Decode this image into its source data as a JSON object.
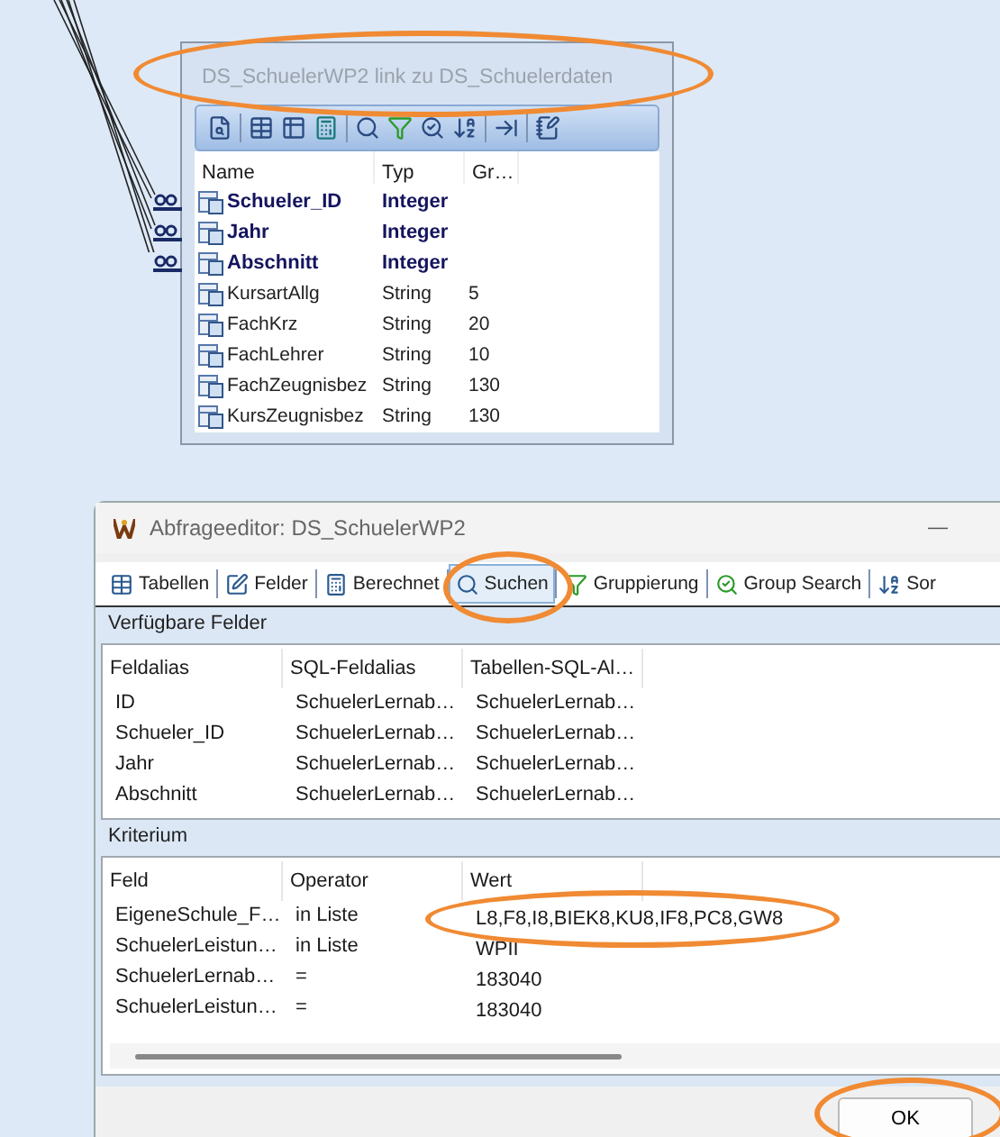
{
  "table_node": {
    "title": "DS_SchuelerWP2 link zu DS_Schuelerdaten",
    "columns": [
      "Name",
      "Typ",
      "Gr…"
    ],
    "fields": [
      {
        "name": "Schueler_ID",
        "type": "Integer",
        "key": true,
        "linked": true
      },
      {
        "name": "Jahr",
        "type": "Integer",
        "key": true,
        "linked": true
      },
      {
        "name": "Abschnitt",
        "type": "Integer",
        "key": true,
        "linked": true
      },
      {
        "name": "KursartAllg",
        "type": "String",
        "size": "5",
        "key": false,
        "linked": false
      },
      {
        "name": "FachKrz",
        "type": "String",
        "size": "20",
        "key": false,
        "linked": false
      },
      {
        "name": "FachLehrer",
        "type": "String",
        "size": "10",
        "key": false,
        "linked": false
      },
      {
        "name": "FachZeugnisbez",
        "type": "String",
        "size": "130",
        "key": false,
        "linked": false
      },
      {
        "name": "KursZeugnisbez",
        "type": "String",
        "size": "130",
        "key": false,
        "linked": false
      }
    ]
  },
  "dialog": {
    "title": "Abfrageeditor: DS_SchuelerWP2",
    "minimize": "—",
    "tabs": [
      {
        "label": "Tabellen",
        "selected": false
      },
      {
        "label": "Felder",
        "selected": false
      },
      {
        "label": "Berechnet",
        "selected": false
      },
      {
        "label": "Suchen",
        "selected": true
      },
      {
        "label": "Gruppierung",
        "selected": false
      },
      {
        "label": "Group Search",
        "selected": false
      },
      {
        "label": "Sor",
        "selected": false
      }
    ],
    "available_fields": {
      "heading": "Verfügbare Felder",
      "columns": [
        "Feldalias",
        "SQL-Feldalias",
        "Tabellen-SQL-Al…"
      ],
      "rows": [
        [
          "ID",
          "SchuelerLernab…",
          "SchuelerLernab…"
        ],
        [
          "Schueler_ID",
          "SchuelerLernab…",
          "SchuelerLernab…"
        ],
        [
          "Jahr",
          "SchuelerLernab…",
          "SchuelerLernab…"
        ],
        [
          "Abschnitt",
          "SchuelerLernab…",
          "SchuelerLernab…"
        ]
      ]
    },
    "criteria": {
      "heading": "Kriterium",
      "columns": [
        "Feld",
        "Operator",
        "Wert"
      ],
      "rows": [
        [
          "EigeneSchule_F…",
          "in Liste",
          "L8,F8,I8,BIEK8,KU8,IF8,PC8,GW8"
        ],
        [
          "SchuelerLeistun…",
          "in Liste",
          "WPII"
        ],
        [
          "SchuelerLernab…",
          "=",
          "183040"
        ],
        [
          "SchuelerLeistun…",
          "=",
          "183040"
        ]
      ]
    },
    "buttons": [
      "OK"
    ]
  }
}
